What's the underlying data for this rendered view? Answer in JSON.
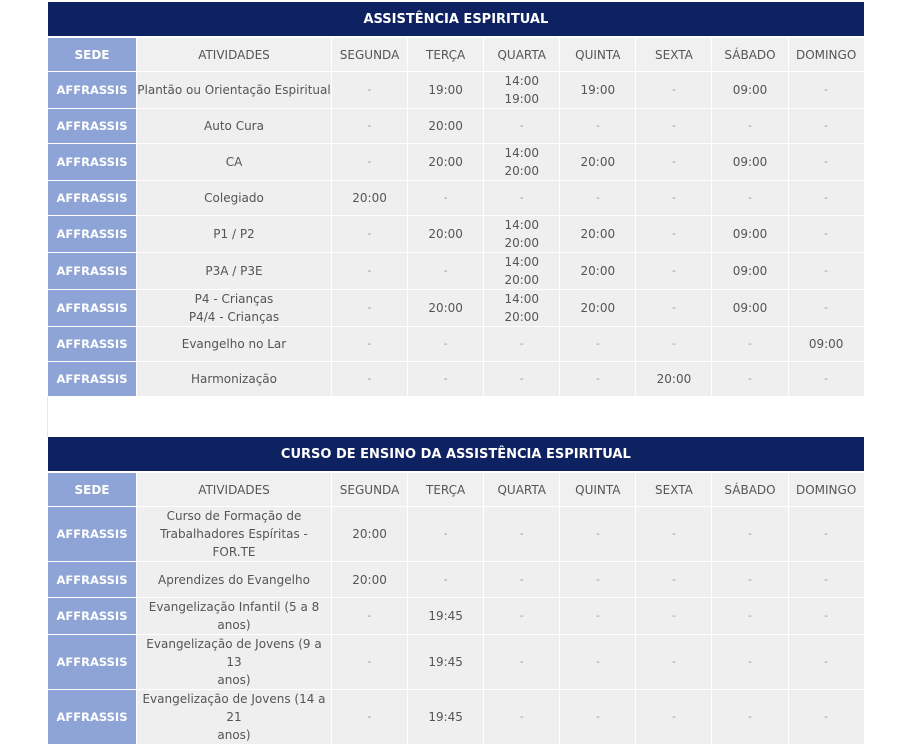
{
  "sections": [
    {
      "title": "ASSISTÊNCIA ESPIRITUAL",
      "headers": [
        "SEDE",
        "ATIVIDADES",
        "SEGUNDA",
        "TERÇA",
        "QUARTA",
        "QUINTA",
        "SEXTA",
        "SÁBADO",
        "DOMINGO"
      ],
      "rows": [
        {
          "sede": "AFFRASSIS",
          "atividade": [
            "Plantão ou Orientação Espiritual"
          ],
          "days": [
            [
              "-"
            ],
            [
              "19:00"
            ],
            [
              "14:00",
              "19:00"
            ],
            [
              "19:00"
            ],
            [
              "-"
            ],
            [
              "09:00"
            ],
            [
              "-"
            ]
          ]
        },
        {
          "sede": "AFFRASSIS",
          "atividade": [
            "Auto Cura"
          ],
          "days": [
            [
              "-"
            ],
            [
              "20:00"
            ],
            [
              "-"
            ],
            [
              "-"
            ],
            [
              "-"
            ],
            [
              "-"
            ],
            [
              "-"
            ]
          ]
        },
        {
          "sede": "AFFRASSIS",
          "atividade": [
            "CA"
          ],
          "days": [
            [
              "-"
            ],
            [
              "20:00"
            ],
            [
              "14:00",
              "20:00"
            ],
            [
              "20:00"
            ],
            [
              "-"
            ],
            [
              "09:00"
            ],
            [
              "-"
            ]
          ]
        },
        {
          "sede": "AFFRASSIS",
          "atividade": [
            "Colegiado"
          ],
          "days": [
            [
              "20:00"
            ],
            [
              "-"
            ],
            [
              "-"
            ],
            [
              "-"
            ],
            [
              "-"
            ],
            [
              "-"
            ],
            [
              "-"
            ]
          ]
        },
        {
          "sede": "AFFRASSIS",
          "atividade": [
            "P1 / P2"
          ],
          "days": [
            [
              "-"
            ],
            [
              "20:00"
            ],
            [
              "14:00",
              "20:00"
            ],
            [
              "20:00"
            ],
            [
              "-"
            ],
            [
              "09:00"
            ],
            [
              "-"
            ]
          ]
        },
        {
          "sede": "AFFRASSIS",
          "atividade": [
            "P3A / P3E"
          ],
          "days": [
            [
              "-"
            ],
            [
              "-"
            ],
            [
              "14:00",
              "20:00"
            ],
            [
              "20:00"
            ],
            [
              "-"
            ],
            [
              "09:00"
            ],
            [
              "-"
            ]
          ]
        },
        {
          "sede": "AFFRASSIS",
          "atividade": [
            "P4 - Crianças",
            "P4/4 - Crianças"
          ],
          "days": [
            [
              "-"
            ],
            [
              "20:00"
            ],
            [
              "14:00",
              "20:00"
            ],
            [
              "20:00"
            ],
            [
              "-"
            ],
            [
              "09:00"
            ],
            [
              "-"
            ]
          ]
        },
        {
          "sede": "AFFRASSIS",
          "atividade": [
            "Evangelho no Lar"
          ],
          "days": [
            [
              "-"
            ],
            [
              "-"
            ],
            [
              "-"
            ],
            [
              "-"
            ],
            [
              "-"
            ],
            [
              "-"
            ],
            [
              "09:00"
            ]
          ]
        },
        {
          "sede": "AFFRASSIS",
          "atividade": [
            "Harmonização"
          ],
          "days": [
            [
              "-"
            ],
            [
              "-"
            ],
            [
              "-"
            ],
            [
              "-"
            ],
            [
              "20:00"
            ],
            [
              "-"
            ],
            [
              "-"
            ]
          ]
        }
      ]
    },
    {
      "title": "CURSO DE ENSINO DA ASSISTÊNCIA ESPIRITUAL",
      "headers": [
        "SEDE",
        "ATIVIDADES",
        "SEGUNDA",
        "TERÇA",
        "QUARTA",
        "QUINTA",
        "SEXTA",
        "SÁBADO",
        "DOMINGO"
      ],
      "rows": [
        {
          "sede": "AFFRASSIS",
          "atividade": [
            "Curso de Formação de",
            "Trabalhadores Espíritas - FOR.TE"
          ],
          "days": [
            [
              "20:00"
            ],
            [
              "-"
            ],
            [
              "-"
            ],
            [
              "-"
            ],
            [
              "-"
            ],
            [
              "-"
            ],
            [
              "-"
            ]
          ]
        },
        {
          "sede": "AFFRASSIS",
          "atividade": [
            "Aprendizes do Evangelho"
          ],
          "days": [
            [
              "20:00"
            ],
            [
              "-"
            ],
            [
              "-"
            ],
            [
              "-"
            ],
            [
              "-"
            ],
            [
              "-"
            ],
            [
              "-"
            ]
          ]
        },
        {
          "sede": "AFFRASSIS",
          "atividade": [
            "Evangelização Infantil (5 a 8 anos)"
          ],
          "days": [
            [
              "-"
            ],
            [
              "19:45"
            ],
            [
              "-"
            ],
            [
              "-"
            ],
            [
              "-"
            ],
            [
              "-"
            ],
            [
              "-"
            ]
          ]
        },
        {
          "sede": "AFFRASSIS",
          "atividade": [
            "Evangelização de Jovens (9 a 13",
            "anos)"
          ],
          "days": [
            [
              "-"
            ],
            [
              "19:45"
            ],
            [
              "-"
            ],
            [
              "-"
            ],
            [
              "-"
            ],
            [
              "-"
            ],
            [
              "-"
            ]
          ]
        },
        {
          "sede": "AFFRASSIS",
          "atividade": [
            "Evangelização de Jovens (14 a 21",
            "anos)"
          ],
          "days": [
            [
              "-"
            ],
            [
              "19:45"
            ],
            [
              "-"
            ],
            [
              "-"
            ],
            [
              "-"
            ],
            [
              "-"
            ],
            [
              "-"
            ]
          ]
        }
      ]
    }
  ]
}
